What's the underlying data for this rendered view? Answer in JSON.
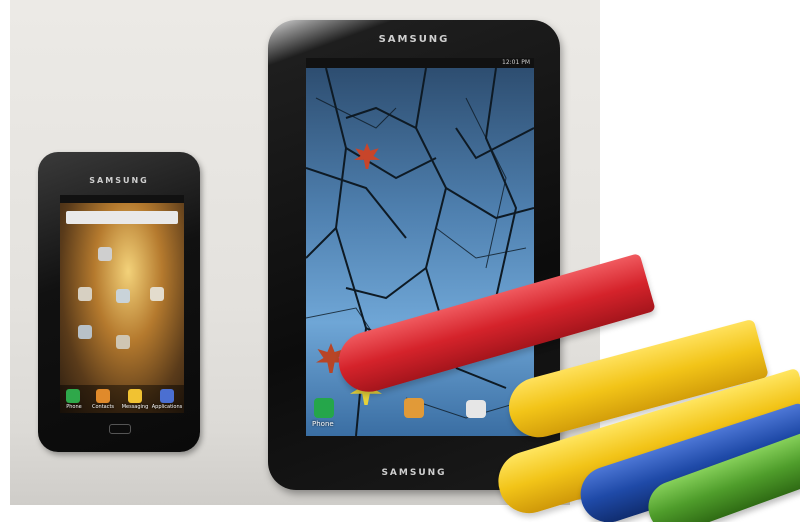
{
  "photo": {
    "phone": {
      "brand": "SAMSUNG",
      "dock_labels": [
        "Phone",
        "Contacts",
        "Messaging",
        "Applications"
      ]
    },
    "tablet": {
      "brand_top": "SAMSUNG",
      "brand_bottom": "SAMSUNG",
      "dock_label": "Phone",
      "status_time": "12:01 PM"
    },
    "crayon_colors": [
      "#d5232b",
      "#f2c418",
      "#1f4aa8",
      "#4f9d2b"
    ]
  }
}
